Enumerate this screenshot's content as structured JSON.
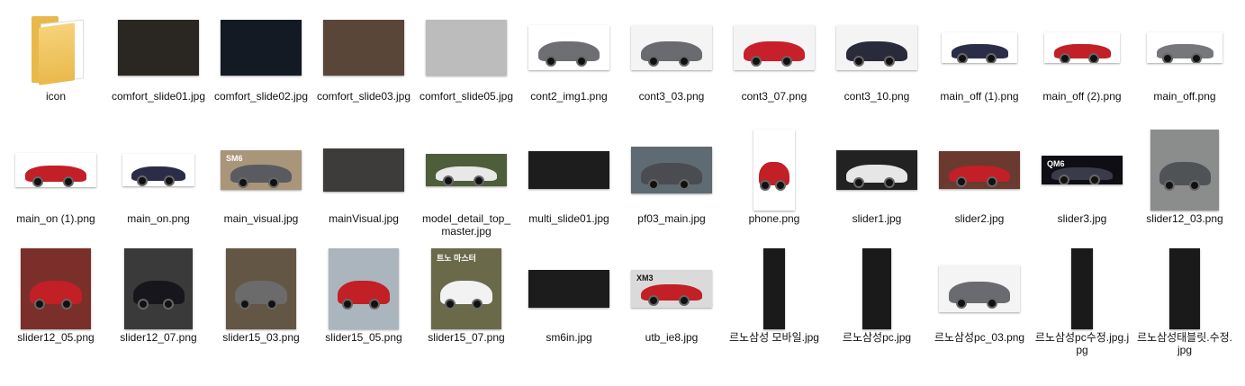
{
  "window": {
    "view": "large-icons",
    "folder_items": 36
  },
  "items": [
    {
      "label": "icon",
      "kind": "folder",
      "icon": "folder-icon"
    },
    {
      "label": "comfort_slide01.jpg",
      "thumb": "dark car interior",
      "bg": "#2a2622"
    },
    {
      "label": "comfort_slide02.jpg",
      "thumb": "digital dashboard",
      "bg": "#141a24"
    },
    {
      "label": "comfort_slide03.jpg",
      "thumb": "brown leather seats",
      "bg": "#5a4638"
    },
    {
      "label": "comfort_slide05.jpg",
      "thumb": "interior ceiling",
      "bg": "#bcbcbc"
    },
    {
      "label": "cont2_img1.png",
      "thumb": "grey sedan",
      "bg": "#ffffff",
      "car": "#6e6f73"
    },
    {
      "label": "cont3_03.png",
      "thumb": "grey sedan web panel",
      "bg": "#f4f4f4",
      "car": "#6a6b70"
    },
    {
      "label": "cont3_07.png",
      "thumb": "red suv web panel",
      "bg": "#f4f4f4",
      "car": "#c8202a"
    },
    {
      "label": "cont3_10.png",
      "thumb": "dark suv web panel",
      "bg": "#f4f4f4",
      "car": "#2a2b3a"
    },
    {
      "label": "main_off (1).png",
      "thumb": "navy suv",
      "bg": "#ffffff",
      "car": "#2b2d48"
    },
    {
      "label": "main_off (2).png",
      "thumb": "red coupe suv",
      "bg": "#ffffff",
      "car": "#c21f26"
    },
    {
      "label": "main_off.png",
      "thumb": "grey sedan",
      "bg": "#ffffff",
      "car": "#75777b"
    },
    {
      "label": "main_on (1).png",
      "thumb": "red coupe suv",
      "bg": "#ffffff",
      "car": "#c21f26"
    },
    {
      "label": "main_on.png",
      "thumb": "navy suv",
      "bg": "#ffffff",
      "car": "#2b2d48"
    },
    {
      "label": "main_visual.jpg",
      "thumb": "sm6 banner",
      "bg": "#a9957a",
      "car": "#5a5b60",
      "text": "SM6"
    },
    {
      "label": "mainVisual.jpg",
      "thumb": "car with phone",
      "bg": "#3e3c3a"
    },
    {
      "label": "model_detail_top_master.jpg",
      "thumb": "van in forest",
      "bg": "#4e5d3a",
      "car": "#e8e8e8"
    },
    {
      "label": "multi_slide01.jpg",
      "thumb": "cockpit interior",
      "bg": "#1d1d1d"
    },
    {
      "label": "pf03_main.jpg",
      "thumb": "sedan at seaside",
      "bg": "#5f6b72",
      "car": "#4a4c52"
    },
    {
      "label": "phone.png",
      "thumb": "phone mockup",
      "bg": "#ffffff",
      "car": "#c21f26"
    },
    {
      "label": "slider1.jpg",
      "thumb": "white suv",
      "bg": "#222",
      "car": "#e6e6e6"
    },
    {
      "label": "slider2.jpg",
      "thumb": "red suv",
      "bg": "#6a3a30",
      "car": "#c21f26"
    },
    {
      "label": "slider3.jpg",
      "thumb": "qm6 banner",
      "bg": "#0e0e14",
      "car": "#3a3b4a",
      "text": "QM6"
    },
    {
      "label": "slider12_03.png",
      "thumb": "grey suv front",
      "bg": "#8a8d8c",
      "car": "#4f5356"
    },
    {
      "label": "slider12_05.png",
      "thumb": "red coupe",
      "bg": "#7a2f2a",
      "car": "#c21f26"
    },
    {
      "label": "slider12_07.png",
      "thumb": "dark suv front",
      "bg": "#3b3a3a",
      "car": "#16161c"
    },
    {
      "label": "slider15_03.png",
      "thumb": "grey sedan street",
      "bg": "#645645",
      "car": "#6b6b6b"
    },
    {
      "label": "slider15_05.png",
      "thumb": "red coupe city",
      "bg": "#aab5bd",
      "car": "#c21f26"
    },
    {
      "label": "slider15_07.png",
      "thumb": "white van",
      "bg": "#6a6a4a",
      "car": "#f2f2f2",
      "text": "트노 마스터"
    },
    {
      "label": "sm6in.jpg",
      "thumb": "sm6 interior",
      "bg": "#1c1c1c"
    },
    {
      "label": "utb_ie8.jpg",
      "thumb": "xm3 banner",
      "bg": "#dadada",
      "car": "#c21f26",
      "text": "XM3"
    },
    {
      "label": "르노삼성 모바일.jpg",
      "thumb": "mobile page",
      "bg": "#1a1a1a"
    },
    {
      "label": "르노삼성pc.jpg",
      "thumb": "pc page",
      "bg": "#1a1a1a"
    },
    {
      "label": "르노삼성pc_03.png",
      "thumb": "grey sedan web panel",
      "bg": "#f4f4f4",
      "car": "#6a6b70"
    },
    {
      "label": "르노삼성pc수정.jpg.jpg",
      "thumb": "pc page edit",
      "bg": "#1a1a1a"
    },
    {
      "label": "르노삼성태블릿.수정.jpg",
      "thumb": "tablet page edit",
      "bg": "#1a1a1a"
    }
  ]
}
